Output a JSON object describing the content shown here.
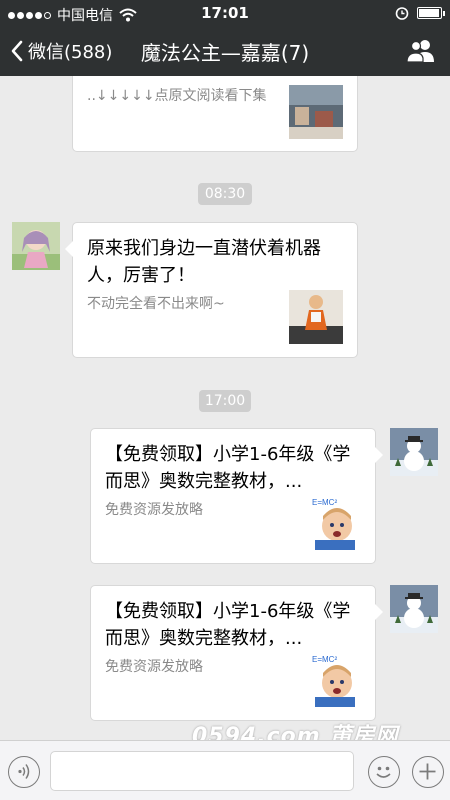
{
  "status_bar": {
    "carrier": "中国电信",
    "time": "17:01",
    "battery_level": 0.95
  },
  "nav": {
    "back_label": "微信(588)",
    "title": "魔法公主—嘉嘉(7)"
  },
  "messages": [
    {
      "type": "link-card",
      "side": "left",
      "desc": "..↓↓↓↓↓点原文阅读看下集"
    },
    {
      "type": "time",
      "text": "08:30"
    },
    {
      "type": "link-card",
      "side": "left",
      "title": "原来我们身边一直潜伏着机器人，厉害了！",
      "desc": "不动完全看不出来啊~"
    },
    {
      "type": "time",
      "text": "17:00"
    },
    {
      "type": "link-card",
      "side": "right",
      "title": "【免费领取】小学1-6年级《学而思》奥数完整教材，...",
      "desc": "免费资源发放略"
    },
    {
      "type": "link-card",
      "side": "right",
      "title": "【免费领取】小学1-6年级《学而思》奥数完整教材，...",
      "desc": "免费资源发放略"
    }
  ],
  "thumb_text": "E=MC²",
  "watermark": "0594.com 莆房网",
  "icons": {
    "back": "chevron-left-icon",
    "group": "group-people-icon",
    "voice": "voice-icon",
    "emoji": "emoji-icon",
    "plus": "plus-icon"
  }
}
